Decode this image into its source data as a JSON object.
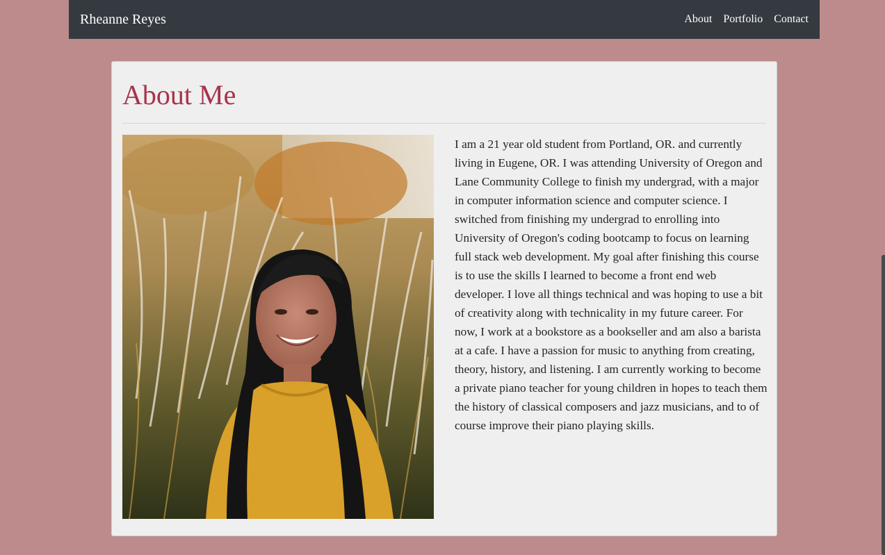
{
  "navbar": {
    "brand": "Rheanne Reyes",
    "links": [
      "About",
      "Portfolio",
      "Contact"
    ]
  },
  "about": {
    "title": "About Me",
    "bio": "I am a 21 year old student from Portland, OR. and currently living in Eugene, OR. I was attending University of Oregon and Lane Community College to finish my undergrad, with a major in computer information science and computer science. I switched from finishing my undergrad to enrolling into University of Oregon's coding bootcamp to focus on learning full stack web development. My goal after finishing this course is to use the skills I learned to become a front end web developer. I love all things technical and was hoping to use a bit of creativity along with technicality in my future career. For now, I work at a bookstore as a bookseller and am also a barista at a cafe. I have a passion for music to anything from creating, theory, history, and listening. I am currently working to become a private piano teacher for young children in hopes to teach them the history of classical composers and jazz musicians, and to of course improve their piano playing skills."
  },
  "colors": {
    "page_background": "#bd8b8b",
    "navbar": "#343a40",
    "card": "#efefef",
    "title": "#a8324a"
  }
}
